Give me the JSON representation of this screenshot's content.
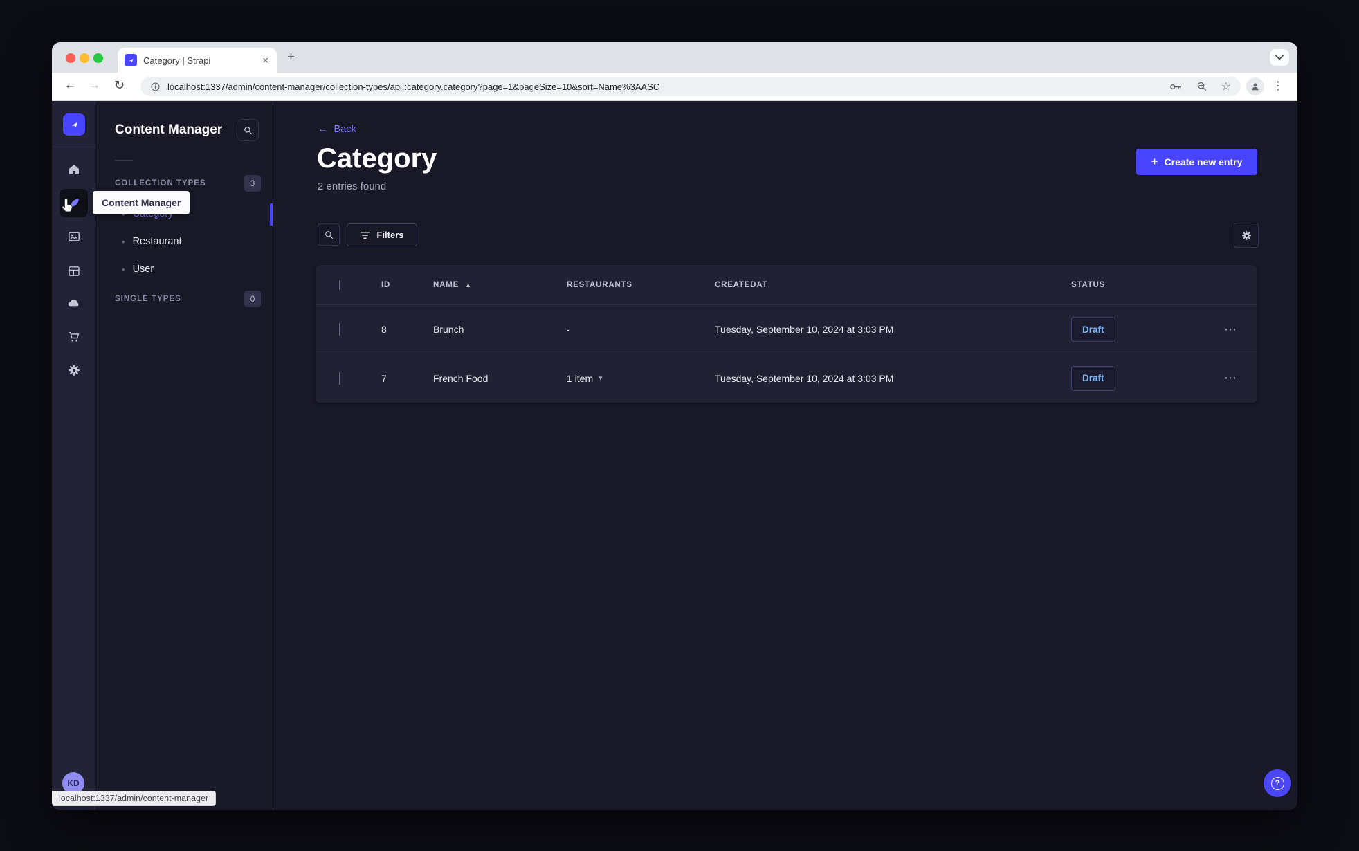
{
  "colors": {
    "accent": "#4945ff",
    "accent_light": "#7b79ff",
    "draft_text": "#7db5f2",
    "page_bg": "#181826",
    "panel_bg": "#212134"
  },
  "glyphs": {
    "close_tab": "×",
    "new_tab": "+",
    "back": "←",
    "forward": "→",
    "reload": "↻",
    "kebab": "⋮",
    "star": "☆",
    "row_menu": "⋯",
    "sort_asc": "▲",
    "item_chevron": "▾",
    "bullet": "•",
    "question": "?",
    "plus": "+"
  },
  "browser": {
    "tab_title": "Category | Strapi",
    "url": "localhost:1337/admin/content-manager/collection-types/api::category.category?page=1&pageSize=10&sort=Name%3AASC",
    "status_bubble": "localhost:1337/admin/content-manager",
    "icons": [
      "site-info",
      "password-key",
      "zoom-in",
      "bookmark-star",
      "profile",
      "menu-kebab",
      "tab-search-chevron"
    ]
  },
  "nav_rail": {
    "icons": [
      "home",
      "content-manager-pen",
      "media-library",
      "content-type-builder",
      "cloud",
      "marketplace-cart",
      "settings-gear"
    ],
    "active_item": "content-manager-pen",
    "user_initials": "KD"
  },
  "subnav": {
    "title": "Content Manager",
    "tooltip": "Content Manager",
    "sections": [
      {
        "label": "COLLECTION TYPES",
        "count": "3",
        "items": [
          {
            "label": "Category",
            "active": true
          },
          {
            "label": "Restaurant",
            "active": false
          },
          {
            "label": "User",
            "active": false
          }
        ]
      },
      {
        "label": "SINGLE TYPES",
        "count": "0",
        "items": []
      }
    ]
  },
  "main": {
    "back_label": "Back",
    "title": "Category",
    "entries_found": "2 entries found",
    "create_button_label": "Create new entry",
    "filters_button_label": "Filters",
    "table": {
      "columns": {
        "id": "ID",
        "name": "NAME",
        "restaurants": "RESTAURANTS",
        "createdat": "CREATEDAT",
        "status": "STATUS"
      },
      "sort": {
        "column": "NAME",
        "direction": "asc"
      },
      "rows": [
        {
          "id": "8",
          "name": "Brunch",
          "restaurants": "-",
          "createdat": "Tuesday, September 10, 2024 at 3:03 PM",
          "status": "Draft"
        },
        {
          "id": "7",
          "name": "French Food",
          "restaurants": "1 item",
          "createdat": "Tuesday, September 10, 2024 at 3:03 PM",
          "status": "Draft"
        }
      ]
    }
  }
}
